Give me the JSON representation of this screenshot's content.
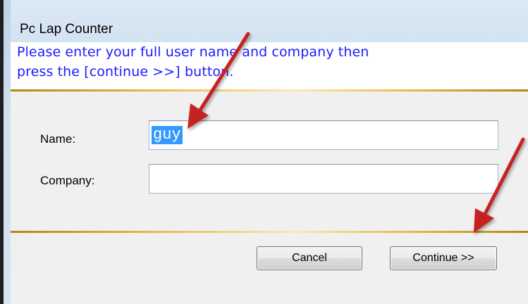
{
  "window": {
    "title": "Pc Lap Counter"
  },
  "header": {
    "line1": "Please enter your full user name and company then",
    "line2": "press the [continue >>] button."
  },
  "form": {
    "name_label": "Name:",
    "name_value": "guy",
    "company_label": "Company:",
    "company_value": ""
  },
  "buttons": {
    "cancel_label": "Cancel",
    "continue_label": "Continue >>"
  },
  "colors": {
    "instruction_text": "#1b1bff",
    "divider_gold": "#d4a62a",
    "selection": "#3399ff",
    "annotation_arrow": "#c62020"
  },
  "annotations": [
    "arrow-to-name-field",
    "arrow-to-continue-button"
  ]
}
